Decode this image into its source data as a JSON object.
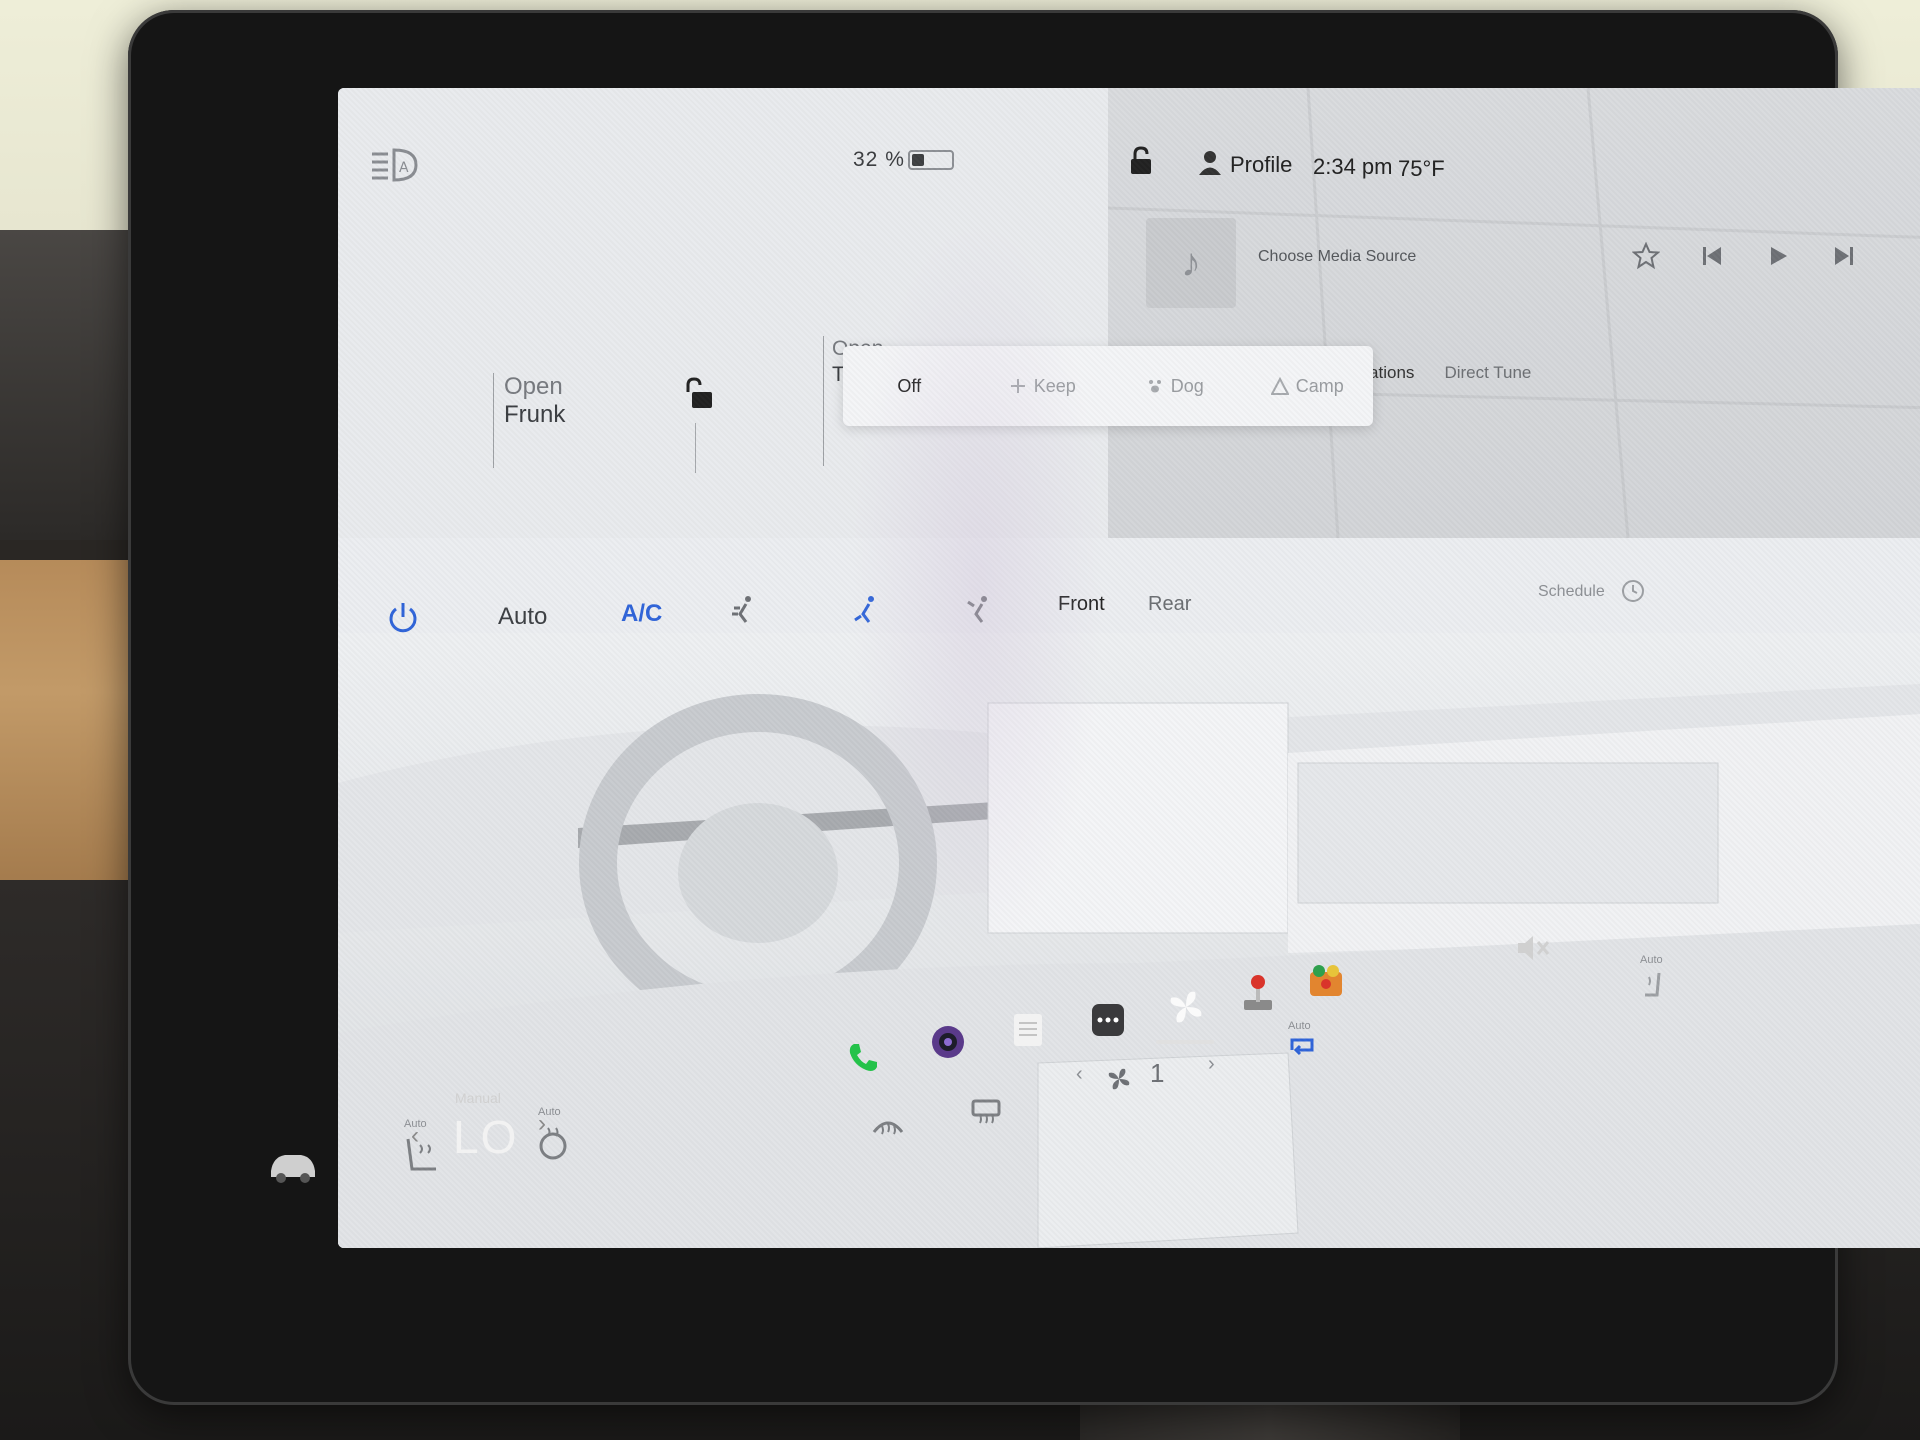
{
  "status_bar": {
    "battery_percent": "32 %",
    "battery_level": 0.32,
    "profile_label": "Profile",
    "time": "2:34 pm",
    "temperature": "75°F"
  },
  "media": {
    "source_label": "Choose Media Source",
    "tabs": {
      "stations": "Stations",
      "direct_tune": "Direct Tune"
    }
  },
  "car_controls": {
    "frunk_line1": "Open",
    "frunk_line2": "Frunk",
    "trunk_line1": "Open",
    "trunk_line2": "Tr"
  },
  "climate_modes": [
    "Off",
    "Keep",
    "Dog",
    "Camp"
  ],
  "climate": {
    "auto_label": "Auto",
    "ac_label": "A/C",
    "front_label": "Front",
    "rear_label": "Rear",
    "schedule_label": "Schedule",
    "fan_speed": "1",
    "seat_auto_label": "Auto",
    "steer_auto_label": "Auto",
    "recirc_auto_label": "Auto",
    "rear_seat_auto_label": "Auto"
  },
  "dock": {
    "temp_mode": "Manual",
    "temperature_setting": "LO",
    "left_arrow": "‹",
    "right_arrow": "›"
  },
  "colors": {
    "accent_blue": "#2f64d9",
    "phone_green": "#24c24a"
  }
}
